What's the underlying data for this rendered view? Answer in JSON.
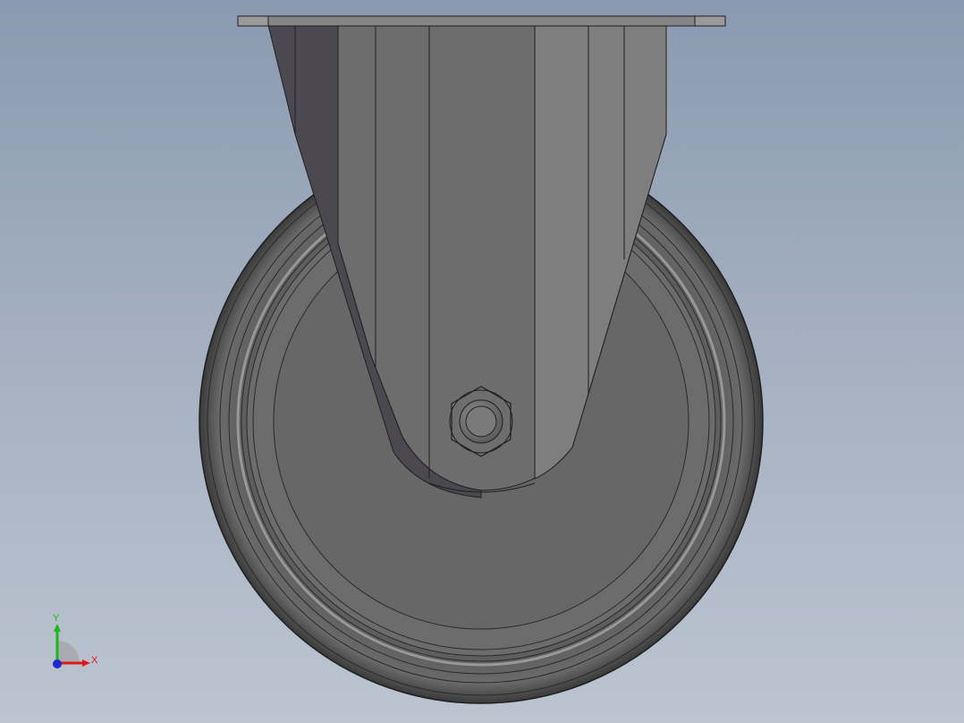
{
  "viewport": {
    "background_top": "#8a9ab0",
    "background_bottom": "#bcc4d0"
  },
  "model": {
    "parts": [
      "mounting-plate",
      "fork",
      "wheel",
      "tire",
      "hub",
      "axle-nut",
      "axle"
    ],
    "color_dark": "#4a474d",
    "color_mid": "#6b6b6b",
    "color_light": "#8f8f8f"
  },
  "triad": {
    "x_label": "X",
    "y_label": "Y",
    "x_color": "#e01818",
    "y_color": "#18b818",
    "z_color": "#1a2ad0"
  }
}
